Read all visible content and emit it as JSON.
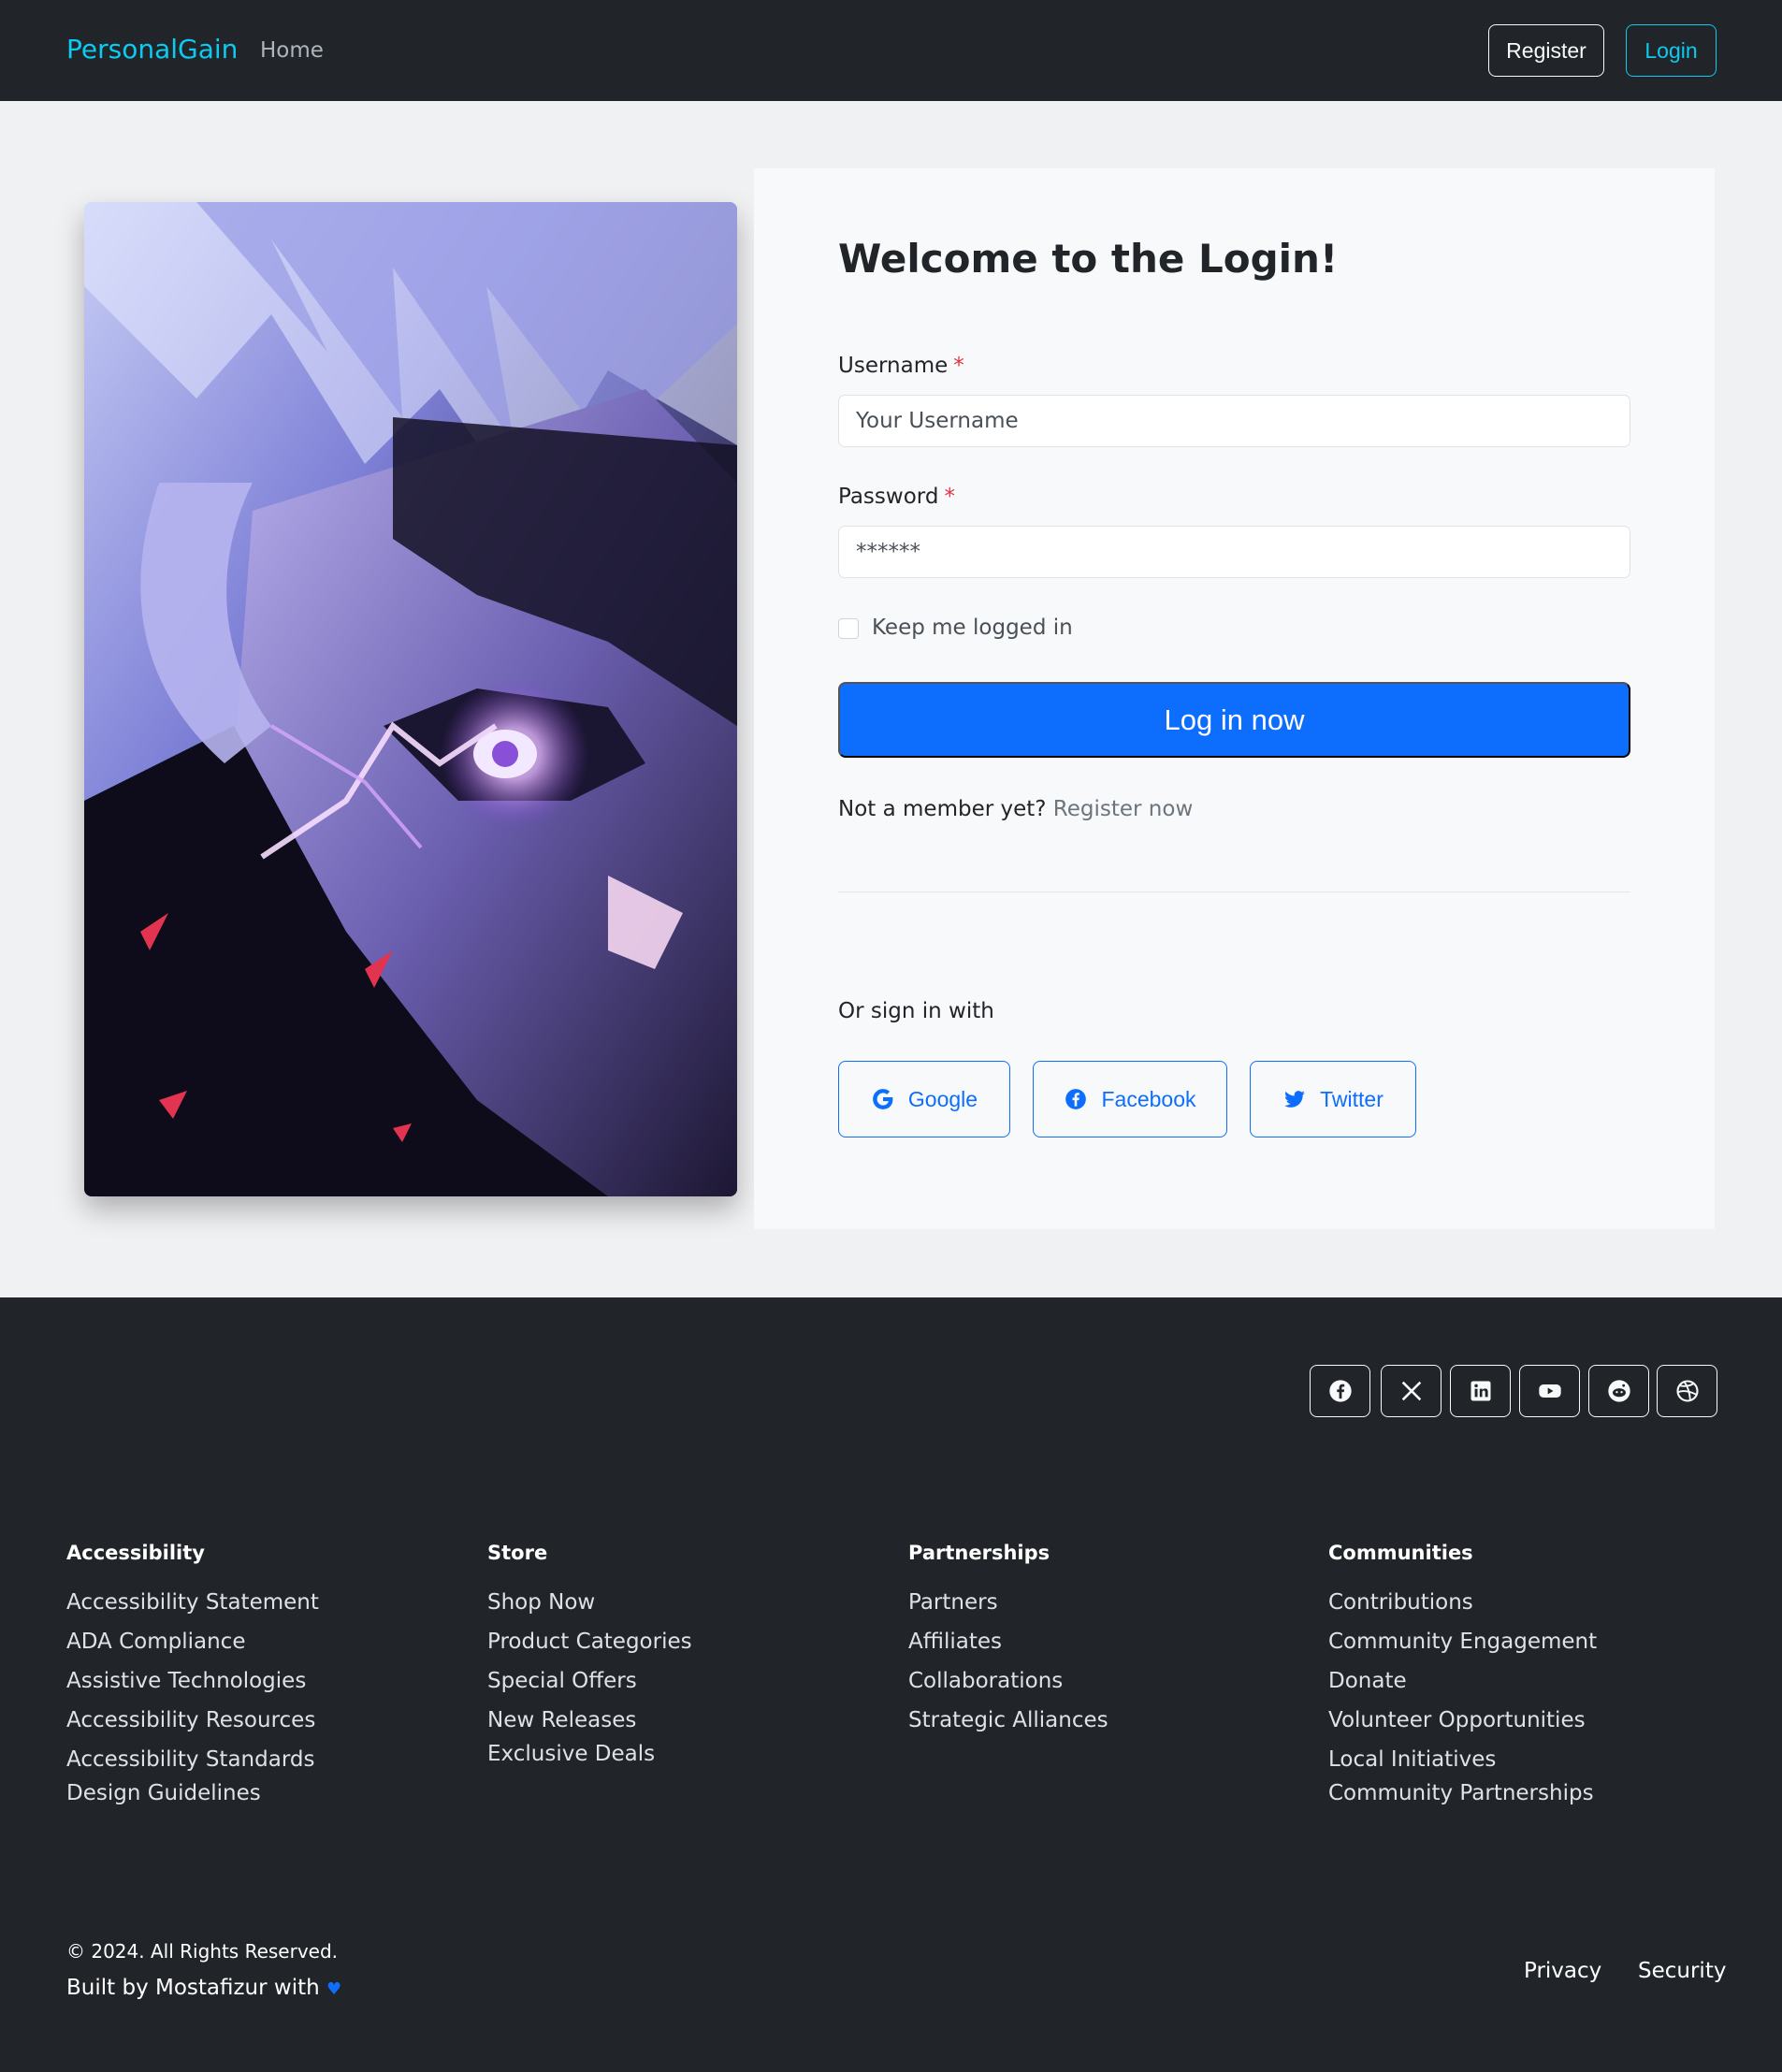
{
  "navbar": {
    "brand": "PersonalGain",
    "home": "Home",
    "register": "Register",
    "login": "Login"
  },
  "login": {
    "title": "Welcome to the Login!",
    "username_label": "Username",
    "username_placeholder": "Your Username",
    "password_label": "Password",
    "password_placeholder": "******",
    "required_mark": "*",
    "keep_logged_in": "Keep me logged in",
    "submit": "Log in now",
    "not_member": "Not a member yet?",
    "register_now": "Register now",
    "or_sign_in": "Or sign in with",
    "social": {
      "google": "Google",
      "facebook": "Facebook",
      "twitter": "Twitter"
    }
  },
  "footer": {
    "social_icons": [
      "facebook-icon",
      "x-icon",
      "linkedin-icon",
      "youtube-icon",
      "reddit-icon",
      "dribbble-icon"
    ],
    "columns": [
      {
        "title": "Accessibility",
        "links": [
          "Accessibility Statement",
          "ADA Compliance",
          "Assistive Technologies",
          "Accessibility Resources",
          "Accessibility Standards",
          "Design Guidelines"
        ]
      },
      {
        "title": "Store",
        "links": [
          "Shop Now",
          "Product Categories",
          "Special Offers",
          "New Releases",
          "Exclusive Deals"
        ]
      },
      {
        "title": "Partnerships",
        "links": [
          "Partners",
          "Affiliates",
          "Collaborations",
          "Strategic Alliances"
        ]
      },
      {
        "title": "Communities",
        "links": [
          "Contributions",
          "Community Engagement",
          "Donate",
          "Volunteer Opportunities",
          "Local Initiatives",
          "Community Partnerships"
        ]
      }
    ],
    "copyright": "© 2024. All Rights Reserved.",
    "built_by": "Built by Mostafizur with",
    "heart": "♥",
    "privacy": "Privacy",
    "security": "Security"
  },
  "colors": {
    "brand": "#0dcaf0",
    "primary": "#0d6efd",
    "dark": "#212529",
    "required": "#dc3545"
  }
}
